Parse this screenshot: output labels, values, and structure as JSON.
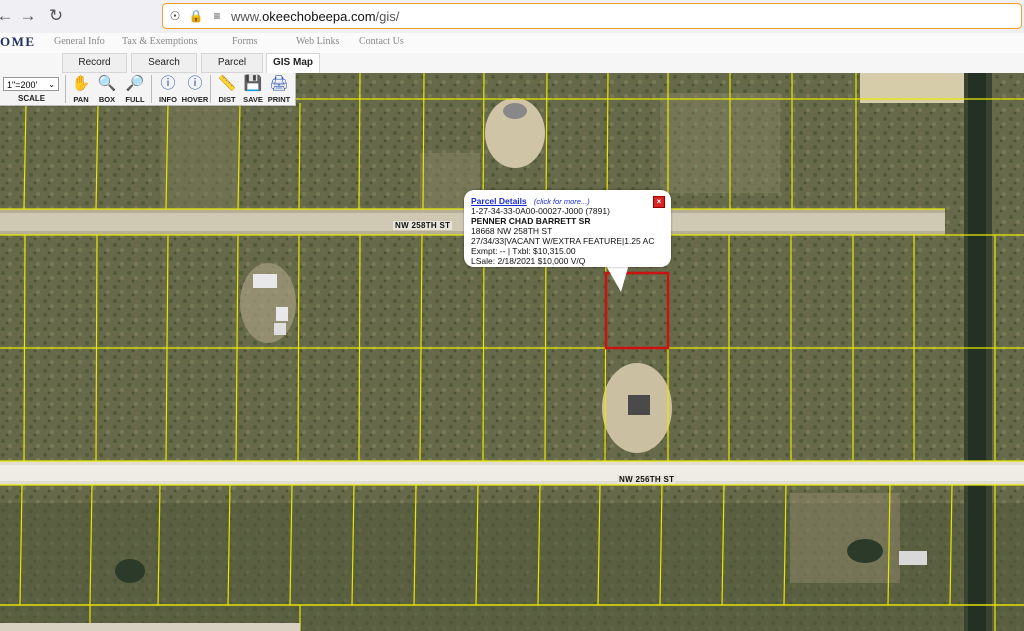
{
  "browser": {
    "url_prefix": "www.",
    "url_domain": "okeechobeepa.com",
    "url_path": "/gis/"
  },
  "site": {
    "logo": "OME",
    "nav": [
      "General Info",
      "Tax & Exemptions",
      "Forms",
      "Web Links",
      "Contact Us"
    ],
    "tabs": [
      "Record Search",
      "Search Results",
      "Parcel Details",
      "GIS Map"
    ],
    "active_tab": "GIS Map"
  },
  "toolbar": {
    "scale_value": "1\"=200'",
    "scale_label": "SCALE",
    "tools": [
      {
        "label": "PAN",
        "icon": "hand-icon"
      },
      {
        "label": "BOX",
        "icon": "zoom-box-icon"
      },
      {
        "label": "FULL",
        "icon": "zoom-full-icon"
      },
      {
        "label": "INFO",
        "icon": "info-icon"
      },
      {
        "label": "HOVER",
        "icon": "hover-info-icon"
      },
      {
        "label": "DIST",
        "icon": "ruler-icon"
      },
      {
        "label": "SAVE",
        "icon": "save-icon"
      },
      {
        "label": "PRINT",
        "icon": "printer-icon"
      }
    ]
  },
  "map": {
    "roads": [
      "NW 258TH ST",
      "NW 256TH ST"
    ],
    "parcel_line_color": "#e8e800",
    "selected_parcel_color": "#cc1111"
  },
  "popup": {
    "title": "Parcel Details",
    "more_link": "(click for more...)",
    "parcel_id": "1-27-34-33-0A00-00027-J000 (7891)",
    "owner": "PENNER CHAD BARRETT SR",
    "address": "18668 NW 258TH ST",
    "legal": "27/34/33|VACANT W/EXTRA FEATURE|1.25 AC",
    "values": "Exmpt: -- | Txbl: $10,315.00",
    "last_sale": "LSale: 2/18/2021 $10,000 V/Q",
    "close_icon": "close-icon"
  }
}
